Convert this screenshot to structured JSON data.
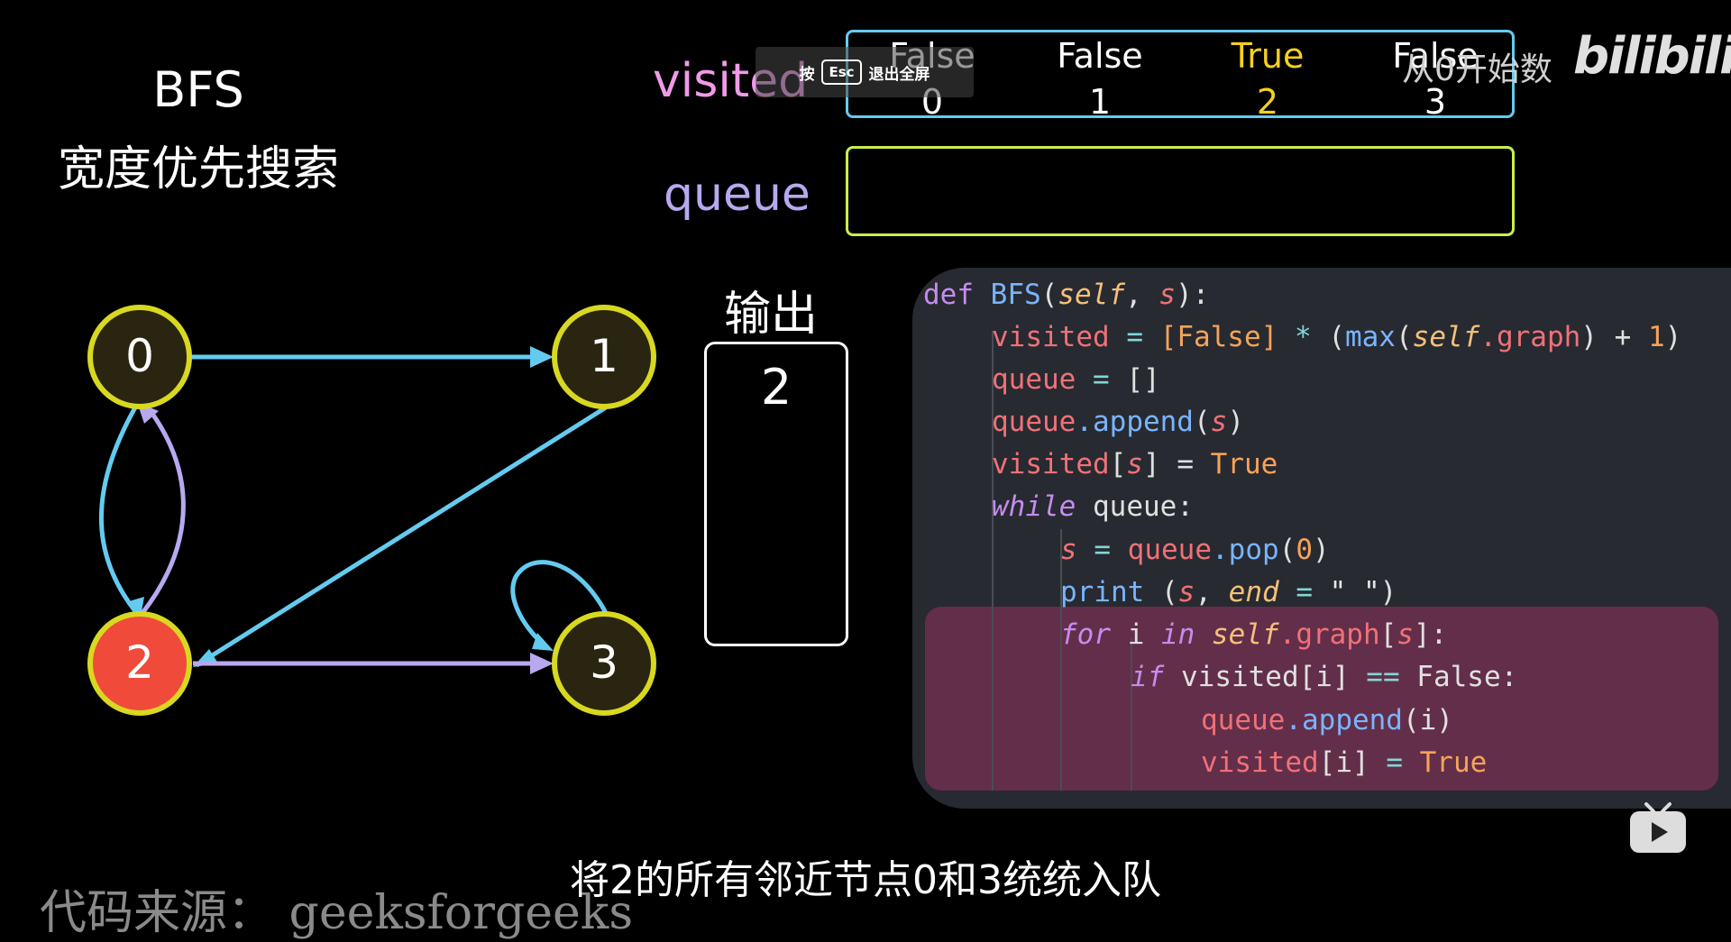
{
  "heading": {
    "line1": "BFS",
    "line2": "宽度优先搜索"
  },
  "visited": {
    "label": "visited",
    "cells": [
      {
        "value": "False",
        "index": "0",
        "color": "#ffffff"
      },
      {
        "value": "False",
        "index": "1",
        "color": "#ffffff"
      },
      {
        "value": "True",
        "index": "2",
        "color": "#f5d020"
      },
      {
        "value": "False",
        "index": "3",
        "color": "#ffffff"
      }
    ]
  },
  "queue": {
    "label": "queue"
  },
  "esc_hint": {
    "press": "按",
    "key": "Esc",
    "action": "退出全屏"
  },
  "output": {
    "label": "输出",
    "values": [
      "2"
    ]
  },
  "graph": {
    "nodes": [
      {
        "id": "0",
        "color": "#2a2510"
      },
      {
        "id": "1",
        "color": "#2a2510"
      },
      {
        "id": "2",
        "color": "#f04a3a"
      },
      {
        "id": "3",
        "color": "#2a2510"
      }
    ],
    "edge_color_blue": "#64cbf0",
    "edge_color_purple": "#b8a8f0",
    "node_border": "#d8d820"
  },
  "code": {
    "l1": {
      "a": "def ",
      "b": "BFS",
      "c": "(",
      "d": "self",
      "e": ", ",
      "f": "s",
      "g": "):"
    },
    "l2": {
      "a": "visited",
      "b": " = ",
      "c": "[False]",
      "d": " * ",
      "e": "(",
      "f": "max",
      "g": "(",
      "h": "self",
      "i": ".graph",
      "j": ") + ",
      "k": "1",
      "l": ")"
    },
    "l3": {
      "a": "queue",
      "b": " = ",
      "c": "[]"
    },
    "l4": {
      "a": "queue",
      "b": ".append",
      "c": "(",
      "d": "s",
      "e": ")"
    },
    "l5": {
      "a": "visited",
      "b": "[",
      "c": "s",
      "d": "] = ",
      "e": "True"
    },
    "l6": {
      "a": "while",
      "b": " queue:"
    },
    "l7": {
      "a": "s",
      "b": " = ",
      "c": "queue",
      "d": ".pop",
      "e": "(",
      "f": "0",
      "g": ")"
    },
    "l8": {
      "a": "print",
      "b": " (",
      "c": "s",
      "d": ", ",
      "e": "end",
      "f": " = ",
      "g": "\" \"",
      "h": ")"
    },
    "l9": {
      "a": "for",
      "b": " i ",
      "c": "in",
      "d": " ",
      "e": "self",
      "f": ".graph",
      "g": "[",
      "h": "s",
      "i": "]:"
    },
    "l10": {
      "a": "if",
      "b": " visited[i] ",
      "c": "==",
      "d": " False:"
    },
    "l11": {
      "a": "queue",
      "b": ".append",
      "c": "(i)"
    },
    "l12": {
      "a": "visited",
      "b": "[i] ",
      "c": "=",
      "d": " True"
    }
  },
  "subtitle": "将2的所有邻近节点0和3统统入队",
  "source": "代码来源： geeksforgeeks",
  "brand": {
    "tagline": "从0开始数",
    "logo": "bilibili"
  }
}
